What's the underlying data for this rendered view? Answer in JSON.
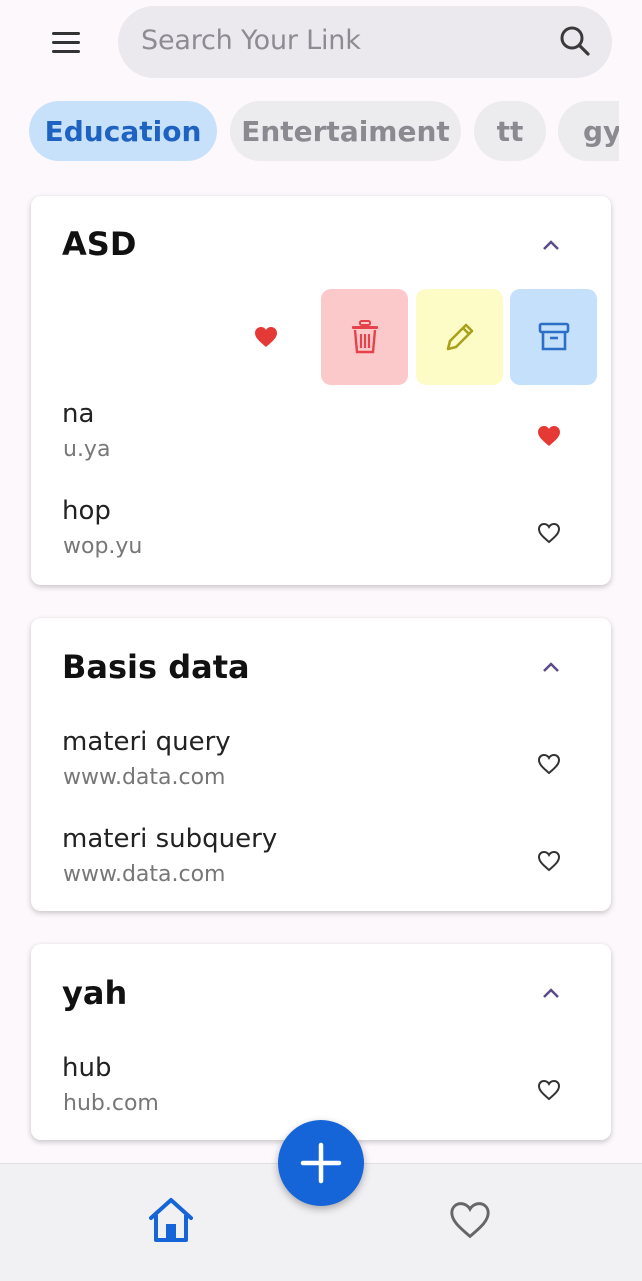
{
  "search": {
    "placeholder": "Search Your Link"
  },
  "categories": [
    {
      "label": "Education",
      "active": true
    },
    {
      "label": "Entertaiment",
      "active": false
    },
    {
      "label": "tt",
      "active": false
    },
    {
      "label": "gy",
      "active": false
    }
  ],
  "groups": [
    {
      "title": "ASD",
      "expanded": true,
      "swiped_row_favorite": true,
      "links": [
        {
          "title": "na",
          "url": "u.ya",
          "favorite": true
        },
        {
          "title": "hop",
          "url": "wop.yu",
          "favorite": false
        }
      ]
    },
    {
      "title": "Basis data",
      "expanded": true,
      "links": [
        {
          "title": "materi query",
          "url": "www.data.com",
          "favorite": false
        },
        {
          "title": "materi subquery",
          "url": "www.data.com",
          "favorite": false
        }
      ]
    },
    {
      "title": "yah",
      "expanded": true,
      "links": [
        {
          "title": "hub",
          "url": "hub.com",
          "favorite": false
        }
      ]
    }
  ],
  "swipe_actions": [
    {
      "name": "delete",
      "icon": "trash-icon",
      "bg": "#fcc9cb",
      "color": "#e4434c"
    },
    {
      "name": "edit",
      "icon": "pencil-icon",
      "bg": "#fdfbc6",
      "color": "#a9a11b"
    },
    {
      "name": "archive",
      "icon": "archive-icon",
      "bg": "#c5e0fb",
      "color": "#2c6fc7"
    }
  ],
  "colors": {
    "accent": "#1565d8",
    "favorite": "#e53935",
    "chevron": "#5c4b8a"
  },
  "bottom_nav": [
    {
      "name": "home",
      "icon": "home-icon",
      "active": true
    },
    {
      "name": "favorites",
      "icon": "heart-outline-icon",
      "active": false
    }
  ]
}
